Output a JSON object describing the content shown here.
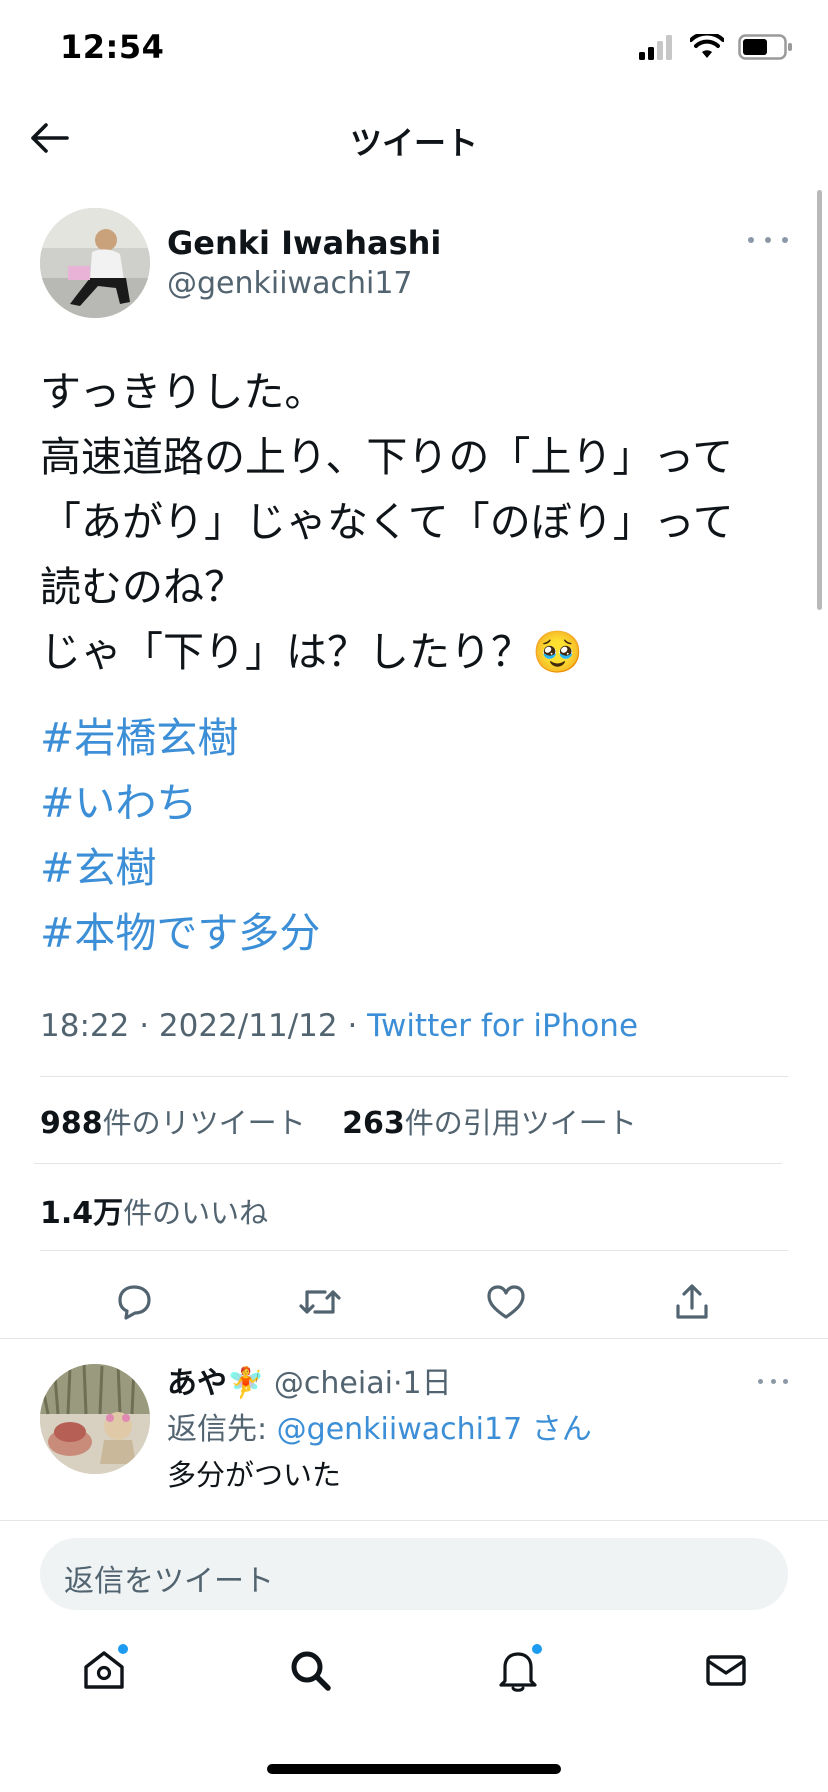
{
  "status_bar": {
    "time": "12:54"
  },
  "header": {
    "title": "ツイート"
  },
  "tweet": {
    "author_name": "Genki Iwahashi",
    "author_handle": "@genkiiwachi17",
    "text": "すっきりした。\n高速道路の上り、下りの「上り」って\n「あがり」じゃなくて「のぼり」って\n読むのね？\nじゃ「下り」は？したり？🥹",
    "hashtags": [
      "#岩橋玄樹",
      "#いわち",
      "#玄樹",
      "#本物です多分"
    ],
    "time": "18:22",
    "date": "2022/11/12",
    "source": "Twitter for iPhone",
    "retweets_count": "988",
    "retweets_label": "件のリツイート",
    "quotes_count": "263",
    "quotes_label": "件の引用ツイート",
    "likes_count": "1.4万",
    "likes_label": "件のいいね"
  },
  "reply": {
    "name": "あや🧚",
    "handle": "@cheiai",
    "time": "1日",
    "reply_to_label": "返信先:",
    "reply_to_handle": "@genkiiwachi17",
    "reply_to_suffix": "さん",
    "text": "多分がついた"
  },
  "composer": {
    "placeholder": "返信をツイート"
  },
  "icons": {
    "back": "arrow-left-icon",
    "more": "more-horizontal-icon",
    "reply": "comment-icon",
    "retweet": "retweet-icon",
    "like": "heart-icon",
    "share": "share-icon",
    "home": "home-icon",
    "search": "search-icon",
    "notifications": "bell-icon",
    "messages": "mail-icon"
  },
  "colors": {
    "link": "#3c8fd6",
    "notification_dot": "#1d9bf0",
    "secondary_text": "#536471"
  }
}
